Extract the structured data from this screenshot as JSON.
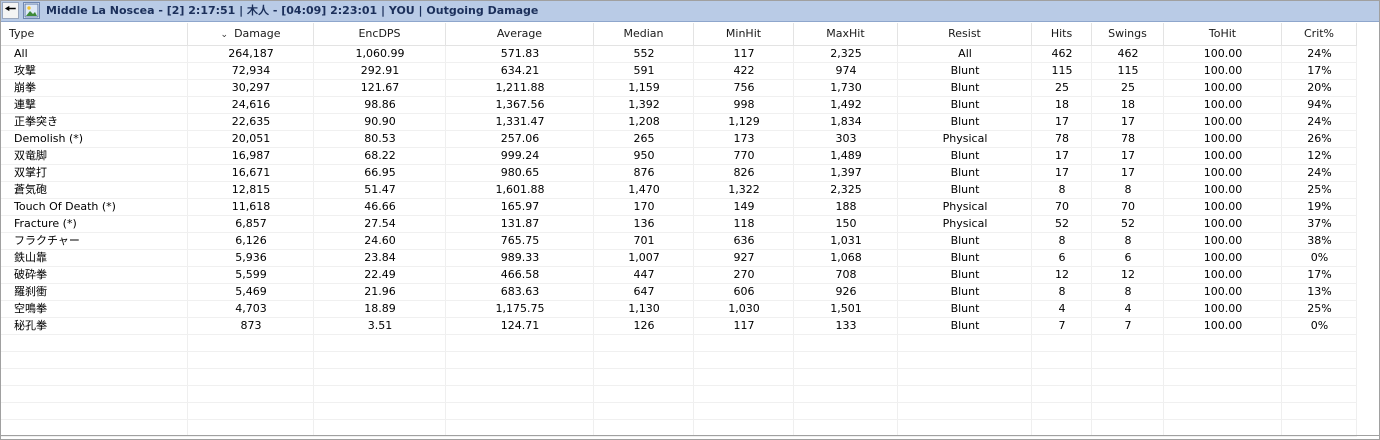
{
  "window": {
    "title": "Middle La Noscea - [2] 2:17:51 | 木人 - [04:09] 2:23:01 | YOU | Outgoing Damage"
  },
  "toolbar": {
    "back_icon": "left-arrow-icon",
    "image_icon": "picture-icon"
  },
  "table": {
    "columns": [
      {
        "key": "type",
        "label": "Type"
      },
      {
        "key": "damage",
        "label": "Damage",
        "sorted": "desc",
        "sort_icon": "chevron-down-icon"
      },
      {
        "key": "encdps",
        "label": "EncDPS"
      },
      {
        "key": "average",
        "label": "Average"
      },
      {
        "key": "median",
        "label": "Median"
      },
      {
        "key": "minhit",
        "label": "MinHit"
      },
      {
        "key": "maxhit",
        "label": "MaxHit"
      },
      {
        "key": "resist",
        "label": "Resist"
      },
      {
        "key": "hits",
        "label": "Hits"
      },
      {
        "key": "swings",
        "label": "Swings"
      },
      {
        "key": "tohit",
        "label": "ToHit"
      },
      {
        "key": "crit",
        "label": "Crit%"
      }
    ],
    "rows": [
      {
        "type": "All",
        "damage": "264,187",
        "encdps": "1,060.99",
        "average": "571.83",
        "median": "552",
        "minhit": "117",
        "maxhit": "2,325",
        "resist": "All",
        "hits": "462",
        "swings": "462",
        "tohit": "100.00",
        "crit": "24%"
      },
      {
        "type": "攻撃",
        "damage": "72,934",
        "encdps": "292.91",
        "average": "634.21",
        "median": "591",
        "minhit": "422",
        "maxhit": "974",
        "resist": "Blunt",
        "hits": "115",
        "swings": "115",
        "tohit": "100.00",
        "crit": "17%"
      },
      {
        "type": "崩拳",
        "damage": "30,297",
        "encdps": "121.67",
        "average": "1,211.88",
        "median": "1,159",
        "minhit": "756",
        "maxhit": "1,730",
        "resist": "Blunt",
        "hits": "25",
        "swings": "25",
        "tohit": "100.00",
        "crit": "20%"
      },
      {
        "type": "連撃",
        "damage": "24,616",
        "encdps": "98.86",
        "average": "1,367.56",
        "median": "1,392",
        "minhit": "998",
        "maxhit": "1,492",
        "resist": "Blunt",
        "hits": "18",
        "swings": "18",
        "tohit": "100.00",
        "crit": "94%"
      },
      {
        "type": "正拳突き",
        "damage": "22,635",
        "encdps": "90.90",
        "average": "1,331.47",
        "median": "1,208",
        "minhit": "1,129",
        "maxhit": "1,834",
        "resist": "Blunt",
        "hits": "17",
        "swings": "17",
        "tohit": "100.00",
        "crit": "24%"
      },
      {
        "type": "Demolish (*)",
        "damage": "20,051",
        "encdps": "80.53",
        "average": "257.06",
        "median": "265",
        "minhit": "173",
        "maxhit": "303",
        "resist": "Physical",
        "hits": "78",
        "swings": "78",
        "tohit": "100.00",
        "crit": "26%"
      },
      {
        "type": "双竜脚",
        "damage": "16,987",
        "encdps": "68.22",
        "average": "999.24",
        "median": "950",
        "minhit": "770",
        "maxhit": "1,489",
        "resist": "Blunt",
        "hits": "17",
        "swings": "17",
        "tohit": "100.00",
        "crit": "12%"
      },
      {
        "type": "双掌打",
        "damage": "16,671",
        "encdps": "66.95",
        "average": "980.65",
        "median": "876",
        "minhit": "826",
        "maxhit": "1,397",
        "resist": "Blunt",
        "hits": "17",
        "swings": "17",
        "tohit": "100.00",
        "crit": "24%"
      },
      {
        "type": "蒼気砲",
        "damage": "12,815",
        "encdps": "51.47",
        "average": "1,601.88",
        "median": "1,470",
        "minhit": "1,322",
        "maxhit": "2,325",
        "resist": "Blunt",
        "hits": "8",
        "swings": "8",
        "tohit": "100.00",
        "crit": "25%"
      },
      {
        "type": "Touch Of Death (*)",
        "damage": "11,618",
        "encdps": "46.66",
        "average": "165.97",
        "median": "170",
        "minhit": "149",
        "maxhit": "188",
        "resist": "Physical",
        "hits": "70",
        "swings": "70",
        "tohit": "100.00",
        "crit": "19%"
      },
      {
        "type": "Fracture (*)",
        "damage": "6,857",
        "encdps": "27.54",
        "average": "131.87",
        "median": "136",
        "minhit": "118",
        "maxhit": "150",
        "resist": "Physical",
        "hits": "52",
        "swings": "52",
        "tohit": "100.00",
        "crit": "37%"
      },
      {
        "type": "フラクチャー",
        "damage": "6,126",
        "encdps": "24.60",
        "average": "765.75",
        "median": "701",
        "minhit": "636",
        "maxhit": "1,031",
        "resist": "Blunt",
        "hits": "8",
        "swings": "8",
        "tohit": "100.00",
        "crit": "38%"
      },
      {
        "type": "鉄山靠",
        "damage": "5,936",
        "encdps": "23.84",
        "average": "989.33",
        "median": "1,007",
        "minhit": "927",
        "maxhit": "1,068",
        "resist": "Blunt",
        "hits": "6",
        "swings": "6",
        "tohit": "100.00",
        "crit": "0%"
      },
      {
        "type": "破砕拳",
        "damage": "5,599",
        "encdps": "22.49",
        "average": "466.58",
        "median": "447",
        "minhit": "270",
        "maxhit": "708",
        "resist": "Blunt",
        "hits": "12",
        "swings": "12",
        "tohit": "100.00",
        "crit": "17%"
      },
      {
        "type": "羅刹衝",
        "damage": "5,469",
        "encdps": "21.96",
        "average": "683.63",
        "median": "647",
        "minhit": "606",
        "maxhit": "926",
        "resist": "Blunt",
        "hits": "8",
        "swings": "8",
        "tohit": "100.00",
        "crit": "13%"
      },
      {
        "type": "空鳴拳",
        "damage": "4,703",
        "encdps": "18.89",
        "average": "1,175.75",
        "median": "1,130",
        "minhit": "1,030",
        "maxhit": "1,501",
        "resist": "Blunt",
        "hits": "4",
        "swings": "4",
        "tohit": "100.00",
        "crit": "25%"
      },
      {
        "type": "秘孔拳",
        "damage": "873",
        "encdps": "3.51",
        "average": "124.71",
        "median": "126",
        "minhit": "117",
        "maxhit": "133",
        "resist": "Blunt",
        "hits": "7",
        "swings": "7",
        "tohit": "100.00",
        "crit": "0%"
      }
    ]
  },
  "colors": {
    "title_bar": "#b9cbe6",
    "title_text": "#1b2f5a",
    "grid_line": "#efefef"
  }
}
